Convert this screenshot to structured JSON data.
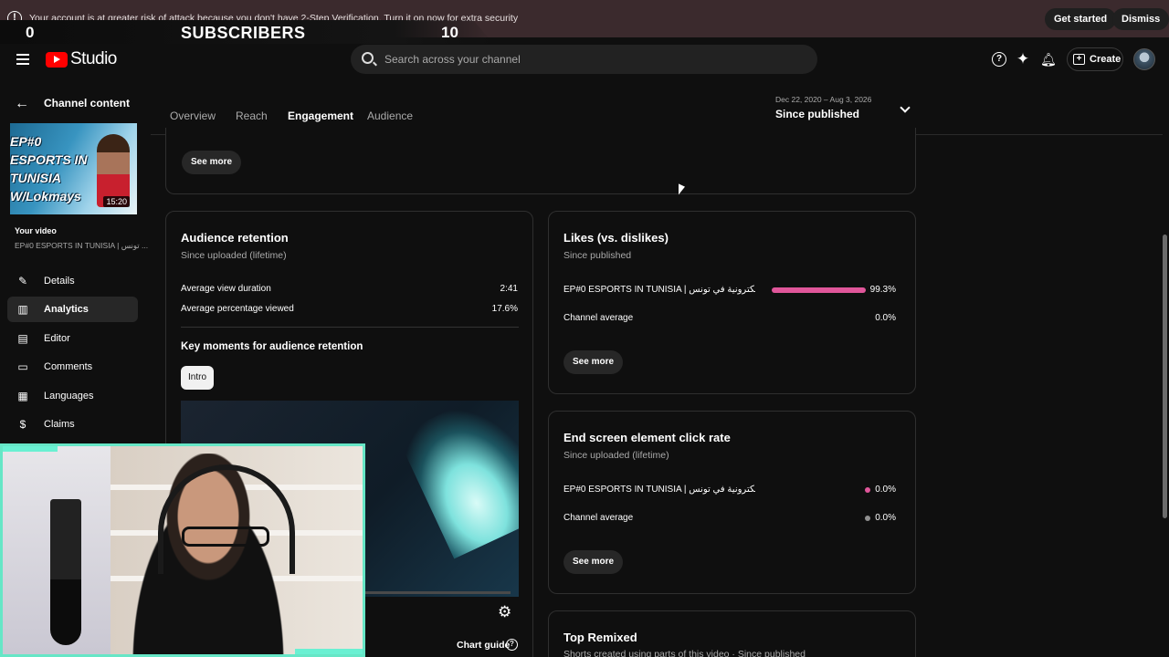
{
  "banner": {
    "message": "Your account is at greater risk of attack because you don't have 2-Step Verification. Turn it on now for extra security",
    "get_started": "Get started",
    "dismiss": "Dismiss"
  },
  "overlay": {
    "left_count": "0",
    "label": "SUBSCRIBERS",
    "right_count": "10"
  },
  "header": {
    "brand": "Studio",
    "search_placeholder": "Search across your channel",
    "create_label": "Create"
  },
  "sidebar": {
    "back_title": "Channel content",
    "thumbnail_text": "EP#0\nESPORTS IN\nTUNISIA\nW/Lokmays",
    "duration": "15:20",
    "your_video_label": "Your video",
    "video_title": "EP#0 ESPORTS IN TUNISIA | تونس ...",
    "items": [
      {
        "label": "Details",
        "icon": "pencil-icon"
      },
      {
        "label": "Analytics",
        "icon": "analytics-icon",
        "active": true
      },
      {
        "label": "Editor",
        "icon": "editor-icon"
      },
      {
        "label": "Comments",
        "icon": "comments-icon"
      },
      {
        "label": "Languages",
        "icon": "languages-icon"
      },
      {
        "label": "Claims",
        "icon": "claims-icon"
      }
    ]
  },
  "tabs": [
    {
      "label": "Overview"
    },
    {
      "label": "Reach"
    },
    {
      "label": "Engagement",
      "active": true
    },
    {
      "label": "Audience"
    }
  ],
  "date_range": {
    "range": "Dec 22, 2020 – Aug 3, 2026",
    "label": "Since published"
  },
  "top_card": {
    "see_more": "See more"
  },
  "retention": {
    "title": "Audience retention",
    "subtitle": "Since uploaded (lifetime)",
    "avg_view_duration_label": "Average view duration",
    "avg_view_duration_value": "2:41",
    "avg_pct_label": "Average percentage viewed",
    "avg_pct_value": "17.6%",
    "key_moments_title": "Key moments for audience retention",
    "chip": "Intro",
    "chart_guide": "Chart guide"
  },
  "likes": {
    "title": "Likes (vs. dislikes)",
    "subtitle": "Since published",
    "video_label": "EP#0 ESPORTS IN TUNISIA | رياضة الالكترونية في تونس...",
    "video_value": "99.3%",
    "video_fraction": 0.993,
    "channel_label": "Channel average",
    "channel_value": "0.0%",
    "see_more": "See more",
    "bar_color": "#e0569a"
  },
  "end_screen": {
    "title": "End screen element click rate",
    "subtitle": "Since uploaded (lifetime)",
    "video_label": "EP#0 ESPORTS IN TUNISIA | رياضة الالكترونية في تونس...",
    "video_value": "0.0%",
    "channel_label": "Channel average",
    "channel_value": "0.0%",
    "see_more": "See more",
    "video_dot_color": "#e0569a",
    "channel_dot_color": "#909090"
  },
  "top_remixed": {
    "title": "Top Remixed",
    "subtitle": "Shorts created using parts of this video · Since published"
  }
}
